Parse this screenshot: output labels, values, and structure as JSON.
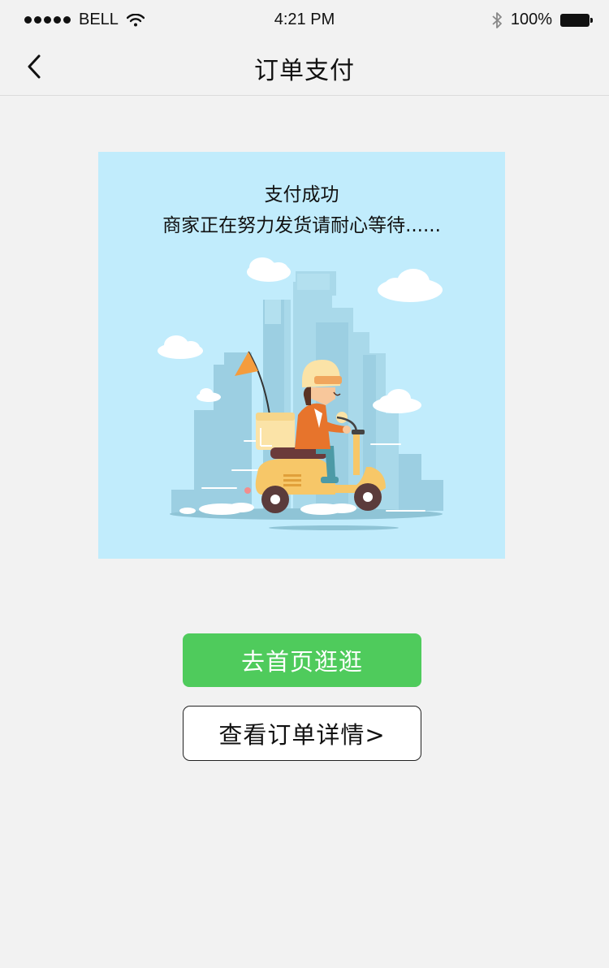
{
  "status_bar": {
    "carrier": "BELL",
    "time": "4:21 PM",
    "battery": "100%",
    "icons": [
      "signal-dots-icon",
      "wifi-icon",
      "bluetooth-icon",
      "battery-icon"
    ]
  },
  "nav": {
    "title": "订单支付",
    "back_icon": "chevron-left-icon"
  },
  "card": {
    "line1": "支付成功",
    "line2": "商家正在努力发货请耐心等待......",
    "illustration": "delivery-scooter-illustration"
  },
  "actions": {
    "primary_label": "去首页逛逛",
    "secondary_label": "查看订单详情>"
  },
  "colors": {
    "background": "#f2f2f2",
    "card_background": "#c1ecfc",
    "primary_button": "#4fcb5c",
    "primary_text": "#ffffff"
  }
}
